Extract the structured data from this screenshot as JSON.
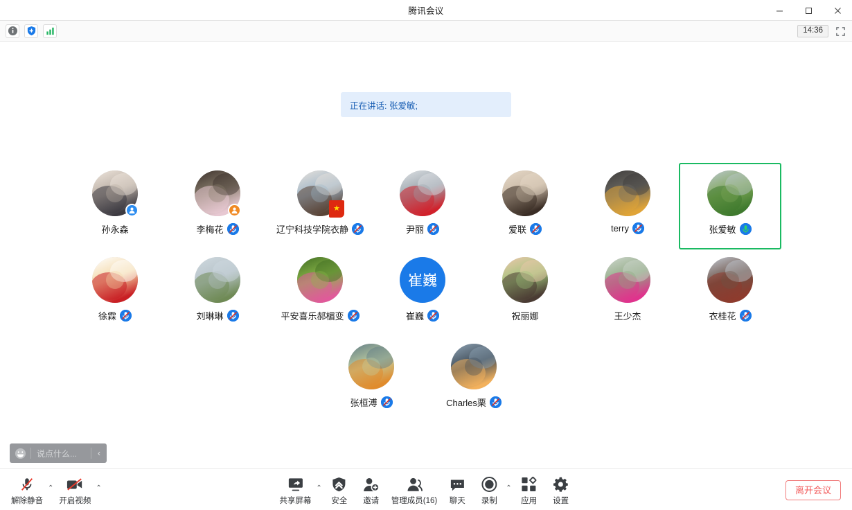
{
  "window": {
    "title": "腾讯会议",
    "minimize_label": "最小化",
    "maximize_label": "最大化",
    "close_label": "关闭"
  },
  "subbar": {
    "icons": [
      {
        "name": "info-icon",
        "glyph": "i"
      },
      {
        "name": "shield-add-icon",
        "glyph": "+"
      },
      {
        "name": "network-signal-icon",
        "glyph": "bars"
      }
    ],
    "clock": "14:36",
    "fullscreen_label": "全屏"
  },
  "stage": {
    "speaking_banner": "正在讲话: 张爱敏;"
  },
  "participants": [
    {
      "name": "孙永森",
      "mic": "none",
      "role": "host",
      "avatar": "photo-man-glasses",
      "avatar_type": "photo",
      "colors": [
        "#efe6dd",
        "#3d3b42",
        "#b9aea4"
      ]
    },
    {
      "name": "李梅花",
      "mic": "muted",
      "role": "cohost",
      "avatar": "photo-cherry-blossom",
      "avatar_type": "photo",
      "colors": [
        "#3a2f2a",
        "#e7c8d2",
        "#8a7f6e"
      ]
    },
    {
      "name": "辽宁科技学院衣静",
      "mic": "muted",
      "role": "flag",
      "avatar": "photo-girl-reading",
      "avatar_type": "photo",
      "colors": [
        "#e8e2dc",
        "#5a4436",
        "#9fb6c8"
      ]
    },
    {
      "name": "尹丽",
      "mic": "muted",
      "role": "none",
      "avatar": "photo-red-dress",
      "avatar_type": "photo",
      "colors": [
        "#dfe3e6",
        "#d1212b",
        "#9aa3ab"
      ]
    },
    {
      "name": "爱联",
      "mic": "muted",
      "role": "none",
      "avatar": "photo-child-dog",
      "avatar_type": "photo",
      "colors": [
        "#e6d9c8",
        "#3a2d25",
        "#c9b9a6"
      ]
    },
    {
      "name": "terry",
      "mic": "muted",
      "role": "none",
      "avatar": "photo-mushrooms",
      "avatar_type": "photo",
      "colors": [
        "#3c3a3a",
        "#e0a437",
        "#6c6a63"
      ]
    },
    {
      "name": "张爱敏",
      "mic": "live",
      "role": "none",
      "avatar": "photo-lotus-field",
      "avatar_type": "photo",
      "colors": [
        "#bcc7cf",
        "#3f7a2e",
        "#7ea758"
      ],
      "active": true
    },
    {
      "name": "徐霖",
      "mic": "muted",
      "role": "none",
      "avatar": "art-mushroom-icon",
      "avatar_type": "photo",
      "colors": [
        "#ffffff",
        "#c91f24",
        "#f3d8a8"
      ]
    },
    {
      "name": "刘琳琳",
      "mic": "muted",
      "role": "none",
      "avatar": "photo-lake-bridge",
      "avatar_type": "photo",
      "colors": [
        "#cfd9df",
        "#6f8a55",
        "#b7c3c9"
      ]
    },
    {
      "name": "平安喜乐郝楣变",
      "mic": "muted",
      "role": "none",
      "avatar": "photo-peony-flowers",
      "avatar_type": "photo",
      "colors": [
        "#3f6b22",
        "#e05a9a",
        "#8cb84a"
      ]
    },
    {
      "name": "崔巍",
      "mic": "muted",
      "role": "none",
      "avatar": "initials-cui-wei",
      "avatar_type": "initials",
      "text": "崔巍",
      "bg": "#1a7ae8"
    },
    {
      "name": "祝丽娜",
      "mic": "none",
      "role": "none",
      "avatar": "photo-umbrella-girl",
      "avatar_type": "photo",
      "colors": [
        "#f0c7ae",
        "#4a3b33",
        "#9fc47a"
      ]
    },
    {
      "name": "王少杰",
      "mic": "none",
      "role": "none",
      "avatar": "photo-pink-cactus",
      "avatar_type": "photo",
      "colors": [
        "#cfd8cf",
        "#e0338d",
        "#8fa882"
      ]
    },
    {
      "name": "衣桂花",
      "mic": "muted",
      "role": "none",
      "avatar": "photo-kremlin-tower",
      "avatar_type": "photo",
      "colors": [
        "#c3cbd5",
        "#8e3b2d",
        "#6d5246"
      ]
    },
    {
      "name": "张桓溥",
      "mic": "muted",
      "role": "none",
      "avatar": "art-autumn-cyclists",
      "avatar_type": "photo",
      "colors": [
        "#5e7b86",
        "#e08b2c",
        "#c2cfa0"
      ]
    },
    {
      "name": "Charles栗",
      "mic": "muted",
      "role": "none",
      "avatar": "photo-sunset-sea",
      "avatar_type": "photo",
      "colors": [
        "#8fa4b6",
        "#f3b15c",
        "#3e4a55"
      ]
    }
  ],
  "chat_input": {
    "emoji_icon": "smiley-icon",
    "placeholder": "说点什么...",
    "collapse_icon": "chevron-left-icon"
  },
  "bottom_bar": {
    "left_tools": [
      {
        "name": "unmute",
        "label": "解除静音",
        "icon": "mic-muted-icon",
        "caret": true
      },
      {
        "name": "start-video",
        "label": "开启视频",
        "icon": "video-off-icon",
        "caret": true
      }
    ],
    "center_tools": [
      {
        "name": "share-screen",
        "label": "共享屏幕",
        "icon": "share-screen-icon",
        "caret": true
      },
      {
        "name": "security",
        "label": "安全",
        "icon": "shield-icon",
        "caret": false
      },
      {
        "name": "invite",
        "label": "邀请",
        "icon": "person-add-icon",
        "caret": false
      },
      {
        "name": "manage-members",
        "label": "管理成员(16)",
        "icon": "people-icon",
        "caret": false
      },
      {
        "name": "chat",
        "label": "聊天",
        "icon": "chat-bubble-icon",
        "caret": false
      },
      {
        "name": "record",
        "label": "录制",
        "icon": "record-icon",
        "caret": true
      },
      {
        "name": "apps",
        "label": "应用",
        "icon": "apps-grid-icon",
        "caret": false
      },
      {
        "name": "settings",
        "label": "设置",
        "icon": "gear-icon",
        "caret": false
      }
    ],
    "leave_label": "离开会议",
    "leave_color": "#f25c5c"
  }
}
